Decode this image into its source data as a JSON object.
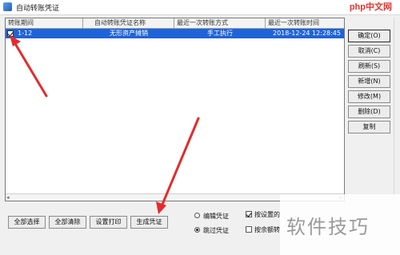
{
  "window": {
    "title": "自动转账凭证"
  },
  "watermark": {
    "top": "php中文网",
    "bottom": "软件技巧"
  },
  "grid": {
    "columns": [
      "转账期间",
      "自动转账凭证名称",
      "最近一次转账方式",
      "最近一次转账时间"
    ],
    "rows": [
      {
        "checked": true,
        "period": "1-12",
        "name": "无形资产摊销",
        "method": "手工执行",
        "time": "2018-12-24 12:28:45"
      }
    ]
  },
  "side_buttons": [
    "确定(O)",
    "取消(C)",
    "刷新(S)",
    "新增(N)",
    "修改(M)",
    "删除(D)",
    "复制"
  ],
  "bottom_buttons": [
    "全部选择",
    "全部清除",
    "设置打印",
    "生成凭证"
  ],
  "options": {
    "radio_edit": "编辑凭证",
    "radio_skip": "跳过凭证",
    "check_1": "按设置的",
    "check_2": "按余额转"
  },
  "colors": {
    "selected_row": "#1f63d8",
    "arrow": "#e52b2b"
  }
}
